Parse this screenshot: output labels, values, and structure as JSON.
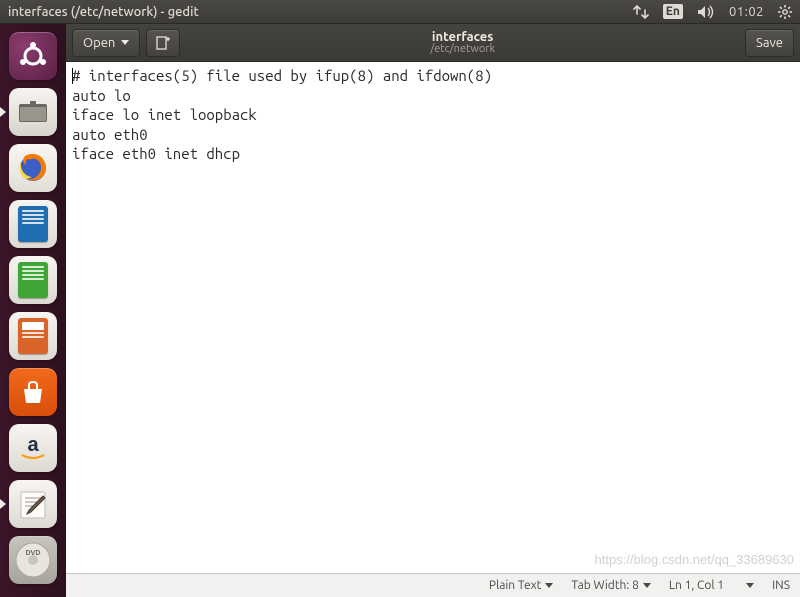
{
  "menubar": {
    "title": "interfaces (/etc/network) - gedit",
    "language_indicator": "En",
    "clock": "01:02"
  },
  "launcher": {
    "items": [
      {
        "name": "dash",
        "tooltip": "Dash"
      },
      {
        "name": "files",
        "tooltip": "Files"
      },
      {
        "name": "firefox",
        "tooltip": "Firefox"
      },
      {
        "name": "writer",
        "tooltip": "LibreOffice Writer"
      },
      {
        "name": "calc",
        "tooltip": "LibreOffice Calc"
      },
      {
        "name": "impress",
        "tooltip": "LibreOffice Impress"
      },
      {
        "name": "software",
        "tooltip": "Ubuntu Software"
      },
      {
        "name": "amazon",
        "tooltip": "Amazon"
      },
      {
        "name": "gedit",
        "tooltip": "Text Editor"
      },
      {
        "name": "disc",
        "tooltip": "Media"
      }
    ]
  },
  "toolbar": {
    "open_label": "Open",
    "save_label": "Save",
    "filename": "interfaces",
    "filepath": "/etc/network"
  },
  "editor": {
    "lines": [
      "# interfaces(5) file used by ifup(8) and ifdown(8)",
      "auto lo",
      "iface lo inet loopback",
      "auto eth0",
      "iface eth0 inet dhcp"
    ]
  },
  "statusbar": {
    "syntax": "Plain Text",
    "tab_label": "Tab Width: 8",
    "position": "Ln 1, Col 1",
    "insert_mode": "INS"
  },
  "watermark": "https://blog.csdn.net/qq_33689630"
}
